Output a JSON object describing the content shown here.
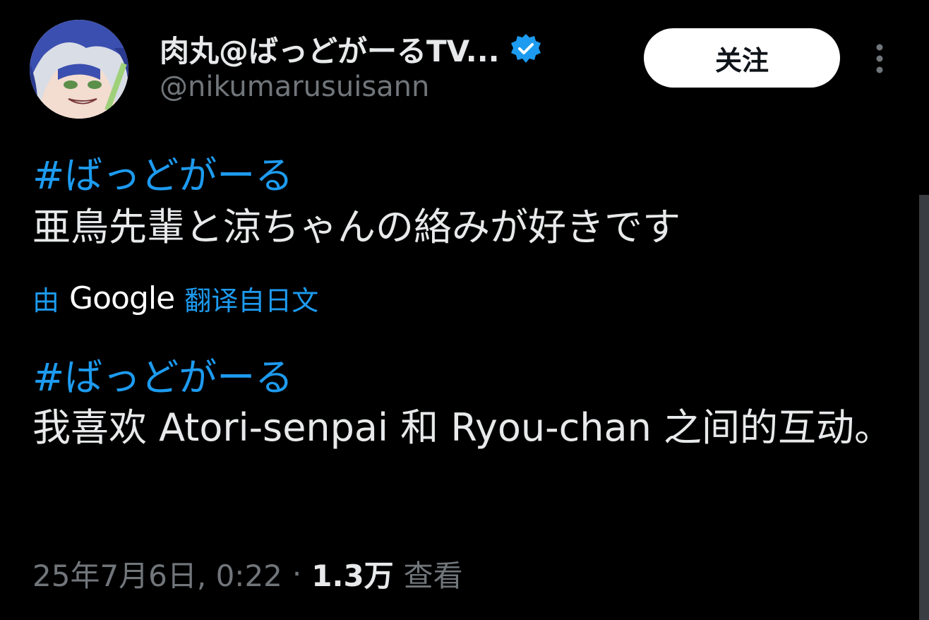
{
  "author": {
    "display_name": "肉丸@ばっどがーるTV...",
    "handle": "@nikumarusuisann",
    "verified": true,
    "avatar_icon": "avatar-icon"
  },
  "actions": {
    "follow_label": "关注",
    "more_icon": "more-vertical-icon"
  },
  "tweet": {
    "original_hashtag": "#ばっどがーる",
    "original_text": "亜鳥先輩と涼ちゃんの絡みが好きです",
    "translation_prefix": "由",
    "translation_provider": "Google",
    "translation_suffix": "翻译自日文",
    "translated_hashtag": "#ばっどがーる",
    "translated_text": "我喜欢 Atori-senpai 和 Ryou-chan 之间的互动。"
  },
  "meta": {
    "timestamp": "25年7月6日, 0:22",
    "separator": "·",
    "views_count": "1.3万",
    "views_label": "查看"
  },
  "colors": {
    "background": "#000000",
    "text": "#e7e9ea",
    "muted": "#71767b",
    "link": "#1d9bf0",
    "verified": "#1d9bf0"
  }
}
